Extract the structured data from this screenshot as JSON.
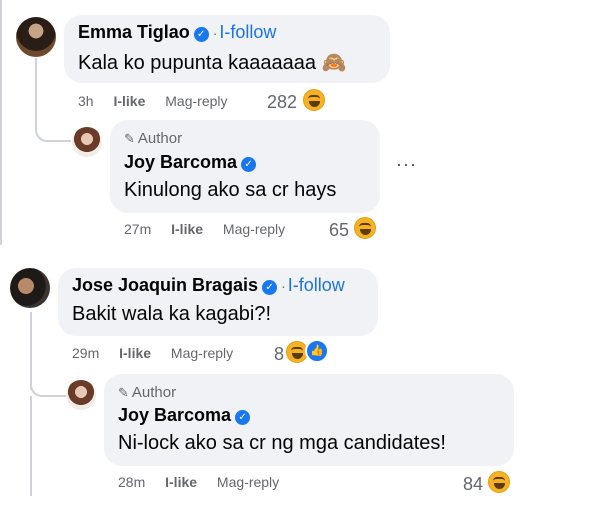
{
  "comments": [
    {
      "name": "Emma Tiglao",
      "follow": "I-follow",
      "text": "Kala ko pupunta kaaaaaaa 🙈",
      "time": "3h",
      "like": "I-like",
      "reply": "Mag-reply",
      "count": "282"
    },
    {
      "author_label": "Author",
      "name": "Joy Barcoma",
      "text": "Kinulong ako sa cr hays",
      "time": "27m",
      "like": "I-like",
      "reply": "Mag-reply",
      "count": "65"
    },
    {
      "name": "Jose Joaquin Bragais",
      "follow": "I-follow",
      "text": "Bakit wala ka kagabi?!",
      "time": "29m",
      "like": "I-like",
      "reply": "Mag-reply",
      "count": "8"
    },
    {
      "author_label": "Author",
      "name": "Joy Barcoma",
      "text": "Ni-lock ako sa cr ng mga candidates!",
      "time": "28m",
      "like": "I-like",
      "reply": "Mag-reply",
      "count": "84"
    }
  ],
  "colors": {
    "accent": "#1877f2",
    "bubble": "#f0f2f5",
    "meta": "#65676b"
  },
  "icons": [
    "verified-badge-icon",
    "pencil-icon",
    "haha-reaction-icon",
    "like-reaction-icon",
    "more-options-icon"
  ]
}
